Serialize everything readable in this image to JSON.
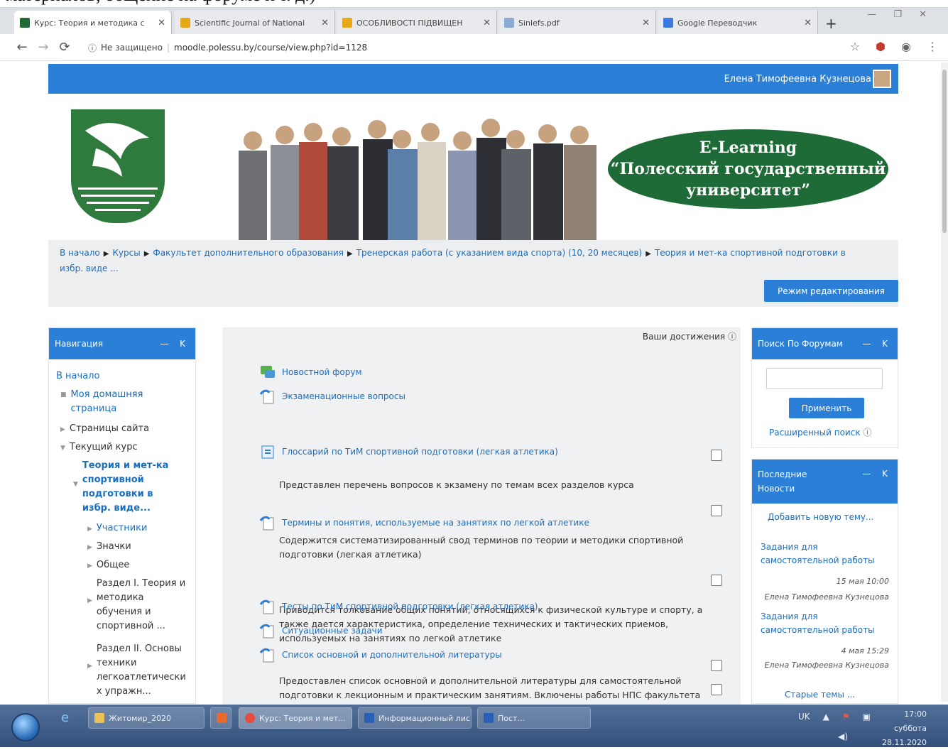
{
  "caption": "материалов, общение на форуме и т. д.)",
  "browser": {
    "tabs": [
      {
        "label": "Курс: Теория и методика с",
        "color": "#1f6b37"
      },
      {
        "label": "Scientific Journal of National",
        "color": "#e6a817"
      },
      {
        "label": "ОСОБЛИВОСТІ ПІДВИЩЕН",
        "color": "#e6a817"
      },
      {
        "label": "Sinlefs.pdf",
        "color": "#8aaad6"
      },
      {
        "label": "Google Переводчик",
        "color": "#3b7be0"
      }
    ],
    "security_label": "Не защищено",
    "url": "moodle.polessu.by/course/view.php?id=1128",
    "window_controls": "— ❐ ✕"
  },
  "header": {
    "user_name": "Елена Тимофеевна Кузнецова"
  },
  "banner": {
    "line1": "E-Learning",
    "line2": "“Полесский государственный",
    "line3": "университет”"
  },
  "breadcrumb": {
    "items": [
      "В начало",
      "Курсы",
      "Факультет дополнительного образования",
      "Тренерская работа (с указанием вида спорта) (10, 20 месяцев)",
      "Теория и мет-ка спортивной подготовки в избр. виде ..."
    ],
    "edit_button": "Режим редактирования"
  },
  "nav_block": {
    "title": "Навигация",
    "controls": "— K",
    "items": [
      {
        "label": "В начало",
        "level": 0
      },
      {
        "label": "Моя домашняя страница",
        "level": 1
      },
      {
        "label": "Страницы сайта",
        "level": 1
      },
      {
        "label": "Текущий курс",
        "level": 1
      },
      {
        "label": "Теория и мет-ка спортивной подготовки в избр. виде...",
        "level": 2
      },
      {
        "label": "Участники",
        "level": 3
      },
      {
        "label": "Значки",
        "level": 3
      },
      {
        "label": "Общее",
        "level": 3
      },
      {
        "label": "Раздел I. Теория и методика обучения и спортивной ...",
        "level": 3
      },
      {
        "label": "Раздел II. Основы техники легкоатлетически х упражн...",
        "level": 3
      }
    ]
  },
  "main": {
    "achievements": "Ваши достижения",
    "activities": [
      {
        "label": "Новостной форум",
        "desc": ""
      },
      {
        "label": "Экзаменационные вопросы",
        "desc": "Представлен перечень вопросов к экзамену по темам всех разделов курса"
      },
      {
        "label": "Глоссарий по ТиМ спортивной подготовки (легкая атлетика)",
        "desc": "Содержится систематизированный свод терминов по теории и методики спортивной подготовки (легкая атлетика)"
      },
      {
        "label": "Термины и понятия, используемые на занятиях по легкой атлетике",
        "desc": "Приводится толкование общих понятий, относящихся к физической культуре и спорту, а также дается характеристика, определение технических и тактических приемов, используемых на занятиях по легкой атлетике"
      },
      {
        "label": "Тесты по ТиМ спортивной подготовки (легкая атлетика)",
        "desc": ""
      },
      {
        "label": "Ситуационные задачи",
        "desc": ""
      },
      {
        "label": "Список основной и дополнительной литературы",
        "desc": "Предоставлен список основной и дополнительной литературы для самостоятельной подготовки к лекционным и практическим занятиям. Включены работы НПС факультета"
      }
    ]
  },
  "forum_search": {
    "title": "Поиск По Форумам",
    "controls": "— K",
    "apply": "Применить",
    "advanced": "Расширенный поиск"
  },
  "latest_news": {
    "title": "Последние Новости",
    "controls": "— K",
    "add_topic": "Добавить новую тему...",
    "items": [
      {
        "title": "Задания для самостоятельной работы",
        "date": "15 мая 10:00",
        "author": "Елена Тимофеевна Кузнецова"
      },
      {
        "title": "Задания для самостоятельной работы",
        "date": "4 мая 15:29",
        "author": "Елена Тимофеевна Кузнецова"
      }
    ],
    "older": "Старые темы ..."
  },
  "taskbar": {
    "items": [
      {
        "label": "Житомир_2020",
        "color": "#e9c35a"
      },
      {
        "label": "",
        "color": "#e86a2c"
      },
      {
        "label": "Курс: Теория и мет...",
        "color": "#e84b3c"
      },
      {
        "label": "Информационный лис...",
        "color": "#2a5fb8"
      },
      {
        "label": "Пост...",
        "color": "#2a5fb8"
      }
    ],
    "lang": "UK",
    "time": "17:00",
    "day": "суббота",
    "date": "28.11.2020"
  }
}
